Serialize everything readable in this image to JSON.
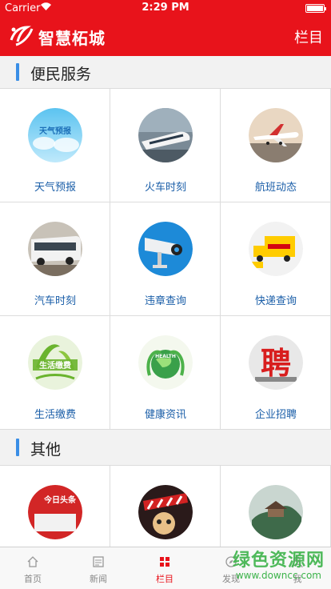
{
  "status_bar": {
    "carrier": "Carrier",
    "time": "2:29 PM"
  },
  "header": {
    "title": "智慧柘城",
    "columns_label": "栏目",
    "accent": "#e8131b"
  },
  "sections": [
    {
      "title": "便民服务",
      "items": [
        {
          "label": "天气预报",
          "icon": "weather-icon"
        },
        {
          "label": "火车时刻",
          "icon": "train-icon"
        },
        {
          "label": "航班动态",
          "icon": "airplane-icon"
        },
        {
          "label": "汽车时刻",
          "icon": "bus-icon"
        },
        {
          "label": "违章查询",
          "icon": "camera-icon"
        },
        {
          "label": "快递查询",
          "icon": "delivery-truck-icon"
        },
        {
          "label": "生活缴费",
          "icon": "bill-payment-icon"
        },
        {
          "label": "健康资讯",
          "icon": "health-globe-icon"
        },
        {
          "label": "企业招聘",
          "icon": "recruitment-icon"
        }
      ]
    },
    {
      "title": "其他",
      "items": [
        {
          "label": "",
          "icon": "news-headline-icon"
        },
        {
          "label": "",
          "icon": "movie-icon"
        },
        {
          "label": "",
          "icon": "scenery-icon"
        }
      ]
    }
  ],
  "icon_texts": {
    "weather": "天气预报",
    "headline": "今日头条",
    "recruit": "聘",
    "bill": "生活缴费",
    "health": "HEALTH"
  },
  "tabbar": {
    "items": [
      {
        "label": "首页",
        "icon": "home-icon"
      },
      {
        "label": "新闻",
        "icon": "news-icon"
      },
      {
        "label": "栏目",
        "icon": "grid-icon",
        "active": true
      },
      {
        "label": "发现",
        "icon": "discover-icon"
      },
      {
        "label": "我",
        "icon": "profile-icon"
      }
    ]
  },
  "watermark": {
    "text": "绿色资源网",
    "url": "www.downcc.com"
  }
}
